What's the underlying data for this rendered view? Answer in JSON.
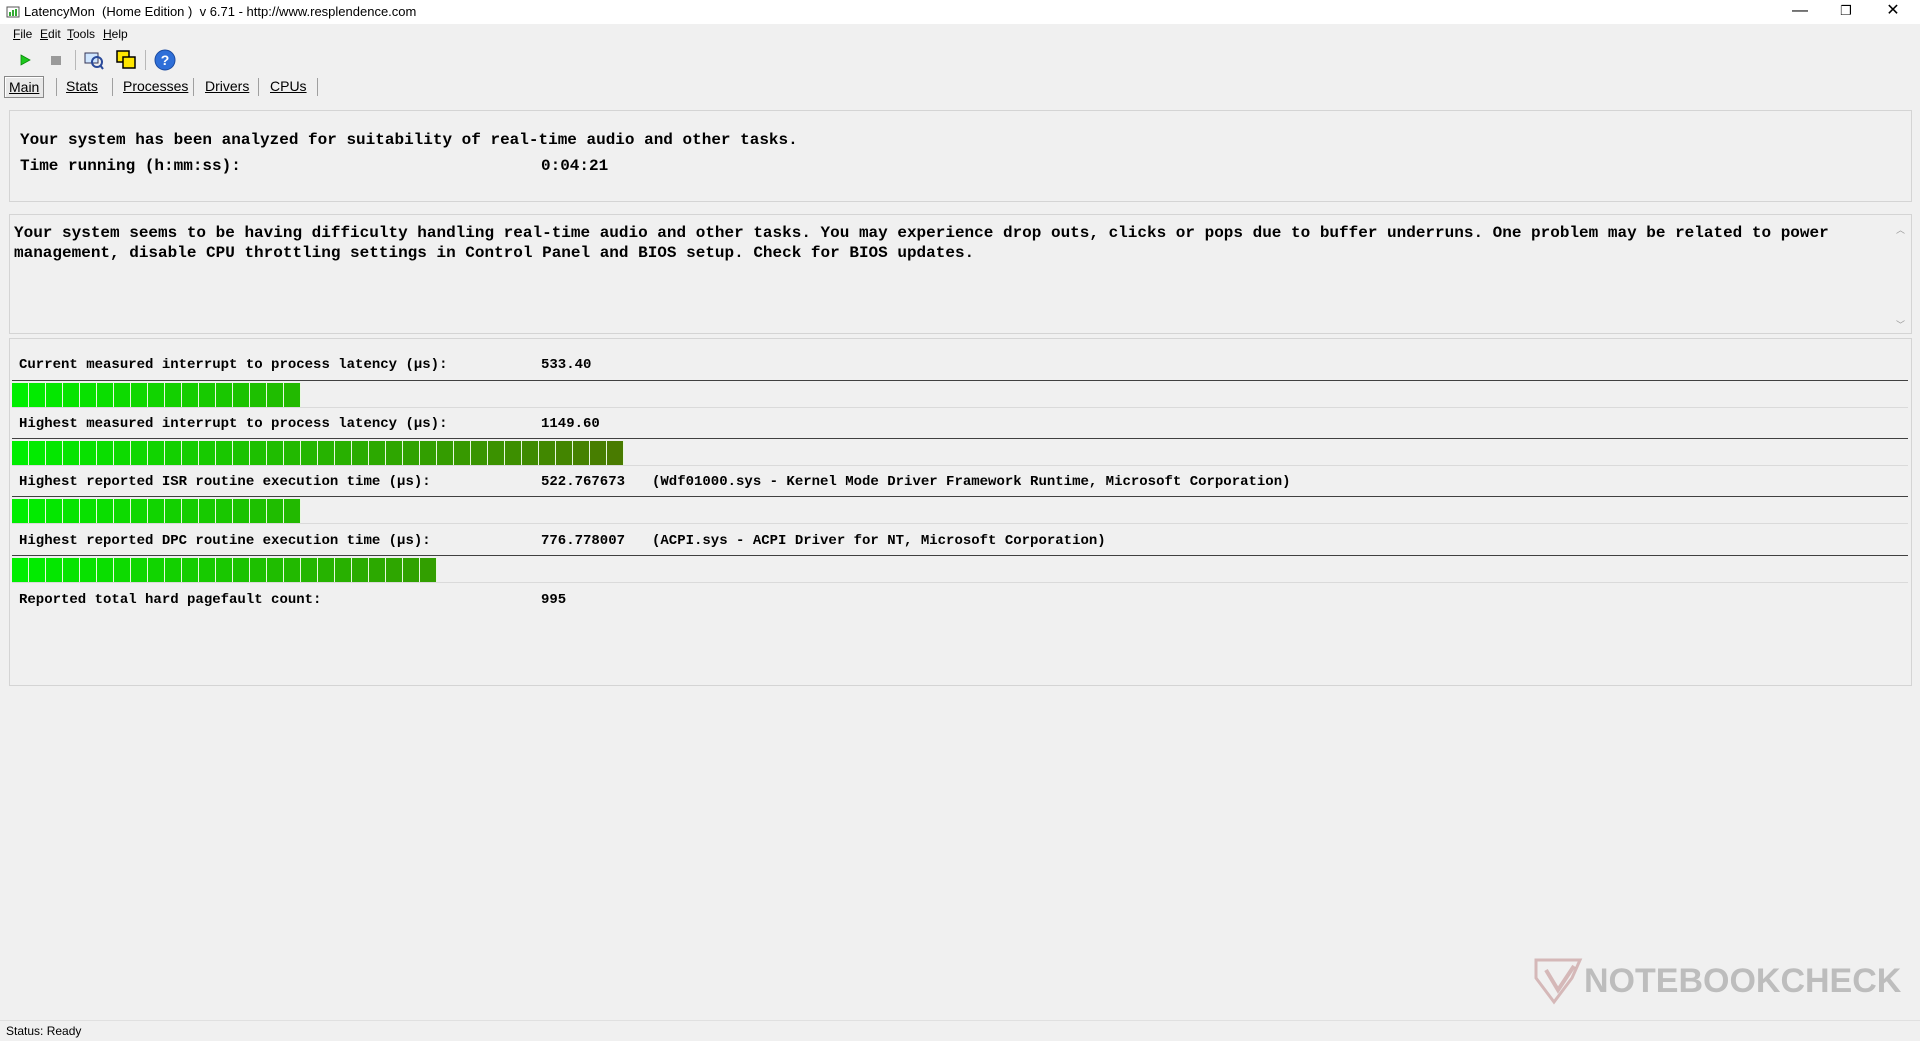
{
  "window": {
    "title": "LatencyMon  (Home Edition )  v 6.71 - http://www.resplendence.com",
    "controls": {
      "minimize": "—",
      "restore": "❐",
      "close": "✕"
    }
  },
  "menu": {
    "items": [
      {
        "underline": "F",
        "rest": "ile"
      },
      {
        "underline": "E",
        "rest": "dit"
      },
      {
        "underline": "T",
        "rest": "ools"
      },
      {
        "underline": "H",
        "rest": "elp"
      }
    ]
  },
  "toolbar": {
    "icons": [
      "play-icon",
      "stop-icon",
      "monitor-icon",
      "windows-icon",
      "help-icon"
    ]
  },
  "tabs": [
    {
      "label": "Main",
      "active": true
    },
    {
      "label": "Stats"
    },
    {
      "label": "Processes"
    },
    {
      "label": "Drivers"
    },
    {
      "label": "CPUs"
    }
  ],
  "summary": {
    "line1": "Your system has been analyzed for suitability of real-time audio and other tasks.",
    "time_label": "Time running (h:mm:ss):",
    "time_value": "0:04:21"
  },
  "message": {
    "text": "Your system seems to be having difficulty handling real-time audio and other tasks. You may experience drop outs, clicks or pops due to buffer underruns. One problem may be related to power management, disable CPU throttling settings in Control Panel and BIOS setup. Check for BIOS updates."
  },
  "metrics": [
    {
      "label": "Current measured interrupt to process latency (µs):",
      "value": "533.40",
      "detail": "",
      "level": 0.154
    },
    {
      "label": "Highest measured interrupt to process latency (µs):",
      "value": "1149.60",
      "detail": "",
      "level": 0.32
    },
    {
      "label": "Highest reported ISR routine execution time (µs):",
      "value": "522.767673",
      "detail": "(Wdf01000.sys - Kernel Mode Driver Framework Runtime, Microsoft Corporation)",
      "level": 0.15
    },
    {
      "label": "Highest reported DPC routine execution time (µs):",
      "value": "776.778007",
      "detail": "(ACPI.sys - ACPI Driver for NT, Microsoft Corporation)",
      "level": 0.22
    }
  ],
  "pagefault": {
    "label": "Reported total hard pagefault count:",
    "value": "995"
  },
  "status": {
    "text": "Status: Ready"
  },
  "watermark": {
    "text": "NOTEBOOKCHECK"
  },
  "colors": {
    "bar_bright": "#00ee00",
    "bar_dark": "#4a7a00"
  }
}
